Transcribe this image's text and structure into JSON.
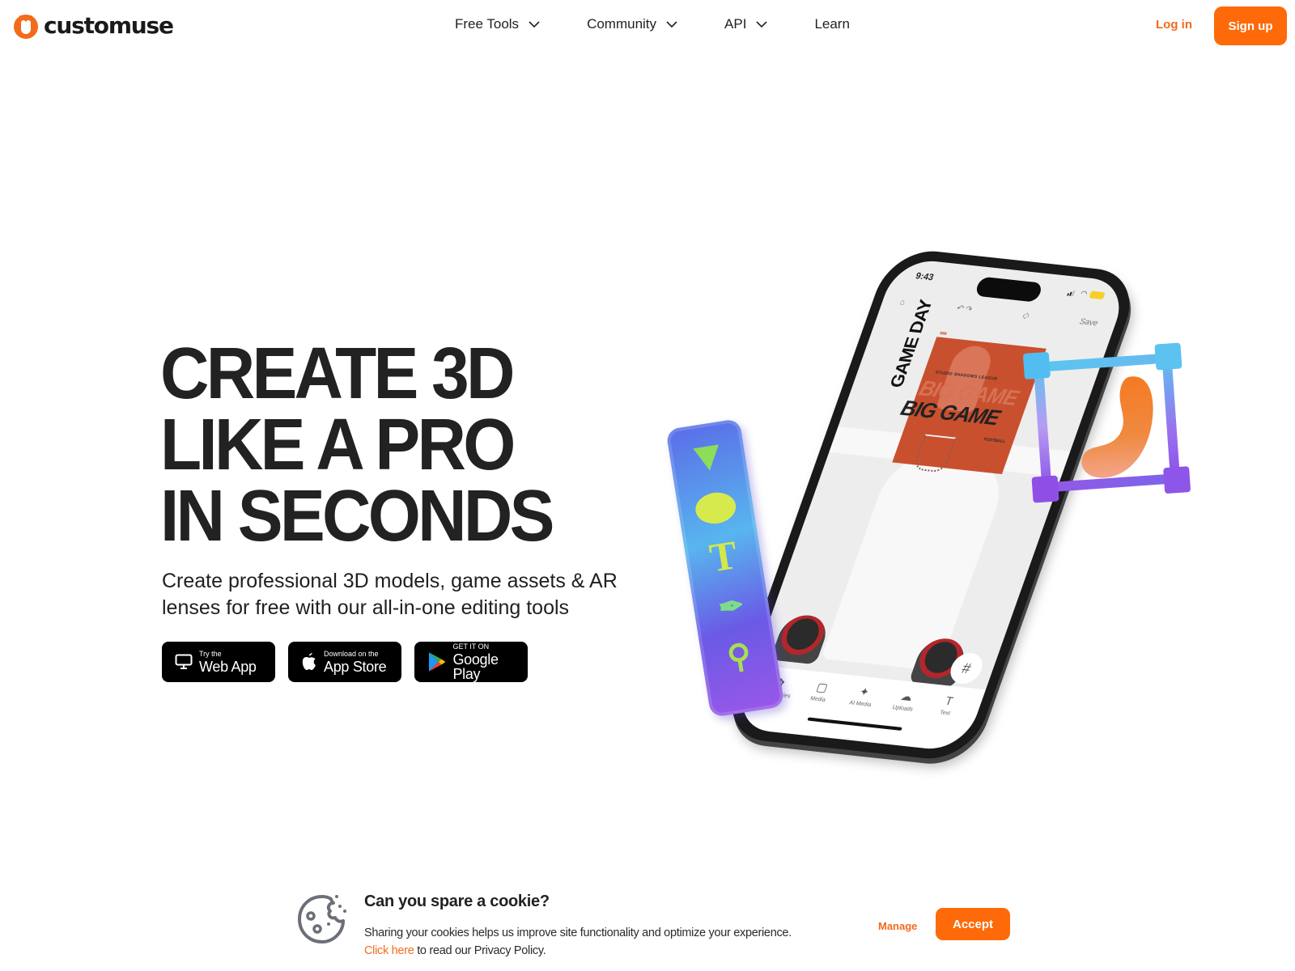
{
  "header": {
    "brand": "customuse",
    "nav": [
      {
        "label": "Free Tools",
        "has_dropdown": true
      },
      {
        "label": "Community",
        "has_dropdown": true
      },
      {
        "label": "API",
        "has_dropdown": true
      },
      {
        "label": "Learn",
        "has_dropdown": false
      }
    ],
    "login_label": "Log in",
    "signup_label": "Sign up"
  },
  "hero": {
    "title_lines": [
      "CREATE 3D",
      "LIKE A PRO",
      "IN SECONDS"
    ],
    "subtitle": "Create professional 3D models, game assets & AR lenses for free with our all-in-one editing tools",
    "buttons": [
      {
        "small": "Try the",
        "big": "Web App",
        "icon": "monitor-icon"
      },
      {
        "small": "Download on the",
        "big": "App Store",
        "icon": "apple-icon"
      },
      {
        "small": "GET IT ON",
        "big": "Google Play",
        "icon": "google-play-icon"
      }
    ]
  },
  "illustration": {
    "phone": {
      "status_time": "9:43",
      "toolbar_save": "Save",
      "poster_league": "STUDIO SHADOWS LEAGUE",
      "poster_title": "BIG GAME",
      "poster_sub": "FOOTBALL",
      "poster_side": "GAME DAY",
      "poster_chevrons": "›››››",
      "hash_label": "#",
      "bottom_items": [
        {
          "label": "Accessories",
          "glyph": "✿"
        },
        {
          "label": "Media",
          "glyph": "▢"
        },
        {
          "label": "AI Media",
          "glyph": "✦"
        },
        {
          "label": "Uploads",
          "glyph": "☁"
        },
        {
          "label": "Text",
          "glyph": "T"
        }
      ]
    },
    "toolbar_glyphs": {
      "text": "T",
      "pen": "✒",
      "dropper": "⚲"
    }
  },
  "cookie": {
    "title": "Can you spare a cookie?",
    "text": "Sharing your cookies helps us improve site functionality and optimize your experience.",
    "link_label": "Click here",
    "link_suffix": " to read our Privacy Policy.",
    "manage_label": "Manage",
    "accept_label": "Accept"
  },
  "colors": {
    "accent": "#fe6a09",
    "link": "#f26b1d",
    "text": "#222222"
  }
}
